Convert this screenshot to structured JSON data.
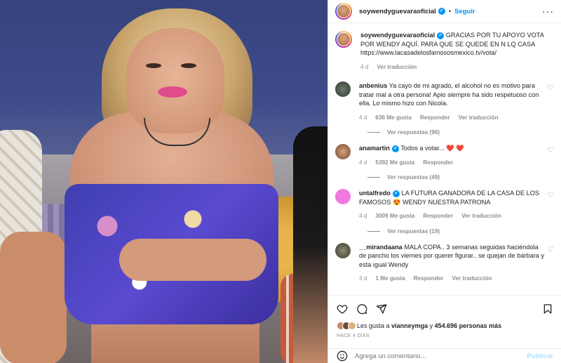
{
  "post": {
    "username": "soywendyguevaraoficial",
    "follow_label": "Seguir",
    "caption_username": "soywendyguevaraoficial",
    "caption_text": "GRACIAS POR TU APOYO VOTA POR WENDY AQUÍ. PARA QUE SE QUEDE EN N LQ CASA https://www.lacasadelosfamososmexico.tv/vota/",
    "caption_time": "4 d",
    "caption_translate": "Ver traducción"
  },
  "comments": [
    {
      "username": "anbenius",
      "text": "Ya cayo de mi agrado, el alcohol no es motivo para tratar mal a otra persona! Apio siempre ha sido respetuoso con ella. Lo mismo hizo con Nicola.",
      "time": "4 d",
      "likes": "636 Me gusta",
      "reply": "Responder",
      "translate": "Ver traducción",
      "replies": "Ver respuestas (96)"
    },
    {
      "username": "anamartin",
      "text": "Todos a votar... ",
      "hearts": "❤️ ❤️",
      "time": "4 d",
      "likes": "5392 Me gusta",
      "reply": "Responder",
      "replies": "Ver respuestas (49)"
    },
    {
      "username": "untalfredo",
      "text": "LA FUTURA GANADORA DE LA CASA DE LOS FAMOSOS 😍 WENDY NUESTRA PATRONA",
      "time": "4 d",
      "likes": "3009 Me gusta",
      "reply": "Responder",
      "translate": "Ver traducción",
      "replies": "Ver respuestas (19)"
    },
    {
      "username": "__mirandaana",
      "text": "MALA COPA.. 3 semanas seguidas haciéndola de pancho los viernes por querer figurar.. se quejan de bárbara y esta igual Wendy",
      "time": "3 d",
      "likes": "1 Me gusta",
      "reply": "Responder",
      "translate": "Ver traducción"
    }
  ],
  "likes_bar": {
    "prefix": "Les gusta a",
    "user": "vianneymga",
    "joiner": "y",
    "count": "454.696 personas más"
  },
  "time_ago": "HACE 4 DÍAS",
  "comment_box": {
    "placeholder": "Agrega un comentario...",
    "post_label": "Publicar"
  },
  "colors": {
    "accent": "#0095f6",
    "heart": "#ed4956"
  }
}
